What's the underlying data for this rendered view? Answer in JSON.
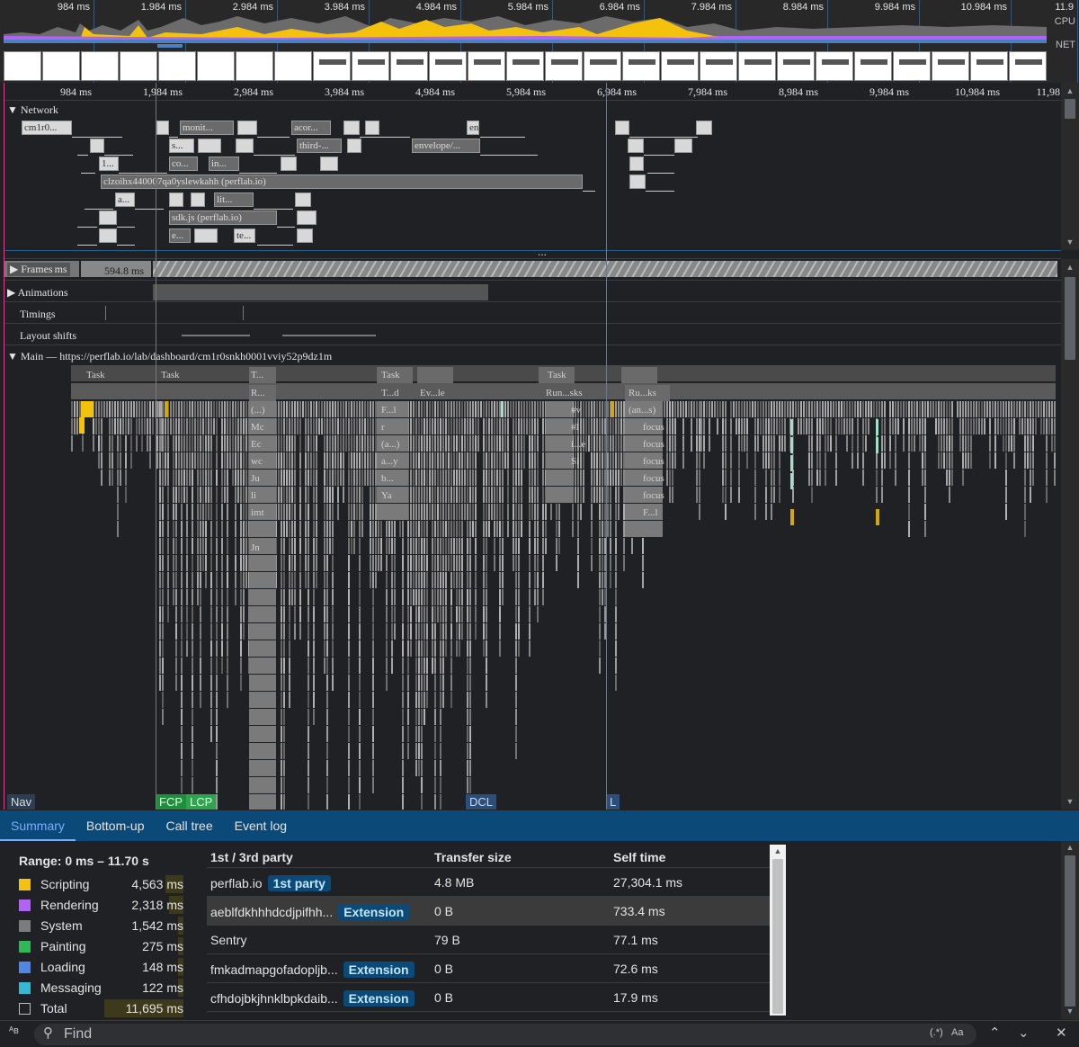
{
  "overview": {
    "ticks": [
      "984 ms",
      "1.984 ms",
      "2.984 ms",
      "3.984 ms",
      "4.984 ms",
      "5.984 ms",
      "6.984 ms",
      "7.984 ms",
      "8.984 ms",
      "9.984 ms",
      "10.984 ms",
      "11.9"
    ],
    "cpu_label": "CPU",
    "net_label": "NET"
  },
  "ruler": {
    "ticks": [
      "984 ms",
      "1,984 ms",
      "2,984 ms",
      "3,984 ms",
      "4,984 ms",
      "5,984 ms",
      "6,984 ms",
      "7,984 ms",
      "8,984 ms",
      "9,984 ms",
      "10,984 ms",
      "11,98"
    ]
  },
  "network": {
    "title": "Network",
    "requests": [
      "cm1r0...",
      "monit...",
      "acor...",
      "en",
      "s...",
      "third-...",
      "envelope/...",
      "1...",
      "co...",
      "in...",
      "clzoihx440007qa0yslewkahh (perflab.io)",
      "a...",
      "lit...",
      "sdk.js (perflab.io)",
      "e...",
      "te..."
    ]
  },
  "tracks": {
    "frames": "Frames",
    "frames_ms": "ms",
    "frames_value": "594.8 ms",
    "animations": "Animations",
    "timings": "Timings",
    "layout_shifts": "Layout shifts",
    "main": "Main — https://perflab.io/lab/dashboard/cm1r0snkh0001vviy52p9dz1m"
  },
  "flame_labels": [
    "Task",
    "Task",
    "Task",
    "Task",
    "T...",
    "R...",
    "(...)",
    "Mc",
    "Ec",
    "wc",
    "Ju",
    "li",
    "imt",
    "Jn",
    "T...d",
    "Ev...le",
    "F...l",
    "r",
    "(a...)",
    "a...y",
    "b...",
    "Ya",
    "Run...sks",
    "#v",
    "#I",
    "i...e",
    "Si",
    "Ru...ks",
    "(an...s)",
    "focus",
    "focus",
    "focus",
    "focus",
    "focus",
    "F...l"
  ],
  "markers": {
    "nav": "Nav",
    "fcp": "FCP",
    "lcp": "LCP",
    "dcl": "DCL",
    "l": "L"
  },
  "tabs": [
    "Summary",
    "Bottom-up",
    "Call tree",
    "Event log"
  ],
  "summary": {
    "range": "Range: 0 ms – 11.70 s",
    "categories": [
      {
        "name": "Scripting",
        "value": "4,563 ms",
        "color": "#f4c20d"
      },
      {
        "name": "Rendering",
        "value": "2,318 ms",
        "color": "#b063f4"
      },
      {
        "name": "System",
        "value": "1,542 ms",
        "color": "#7c7c7c"
      },
      {
        "name": "Painting",
        "value": "275 ms",
        "color": "#2fb856"
      },
      {
        "name": "Loading",
        "value": "148 ms",
        "color": "#4e87e8"
      },
      {
        "name": "Messaging",
        "value": "122 ms",
        "color": "#33b9d4"
      },
      {
        "name": "Total",
        "value": "11,695 ms",
        "color": "#202124"
      }
    ],
    "table": {
      "headers": [
        "1st / 3rd party",
        "Transfer size",
        "Self time"
      ],
      "rows": [
        {
          "name": "perflab.io",
          "badge": "1st party",
          "size": "4.8 MB",
          "time": "27,304.1 ms"
        },
        {
          "name": "aeblfdkhhhdcdjpifhh...",
          "badge": "Extension",
          "size": "0 B",
          "time": "733.4 ms"
        },
        {
          "name": "Sentry",
          "badge": "",
          "size": "79 B",
          "time": "77.1 ms"
        },
        {
          "name": "fmkadmapgofadopljb...",
          "badge": "Extension",
          "size": "0 B",
          "time": "72.6 ms"
        },
        {
          "name": "cfhdojbkjhnklbpkdaib...",
          "badge": "Extension",
          "size": "0 B",
          "time": "17.9 ms"
        }
      ]
    }
  },
  "find": {
    "placeholder": "Find",
    "regex_label": "(.*)",
    "case_label": "Aa"
  }
}
